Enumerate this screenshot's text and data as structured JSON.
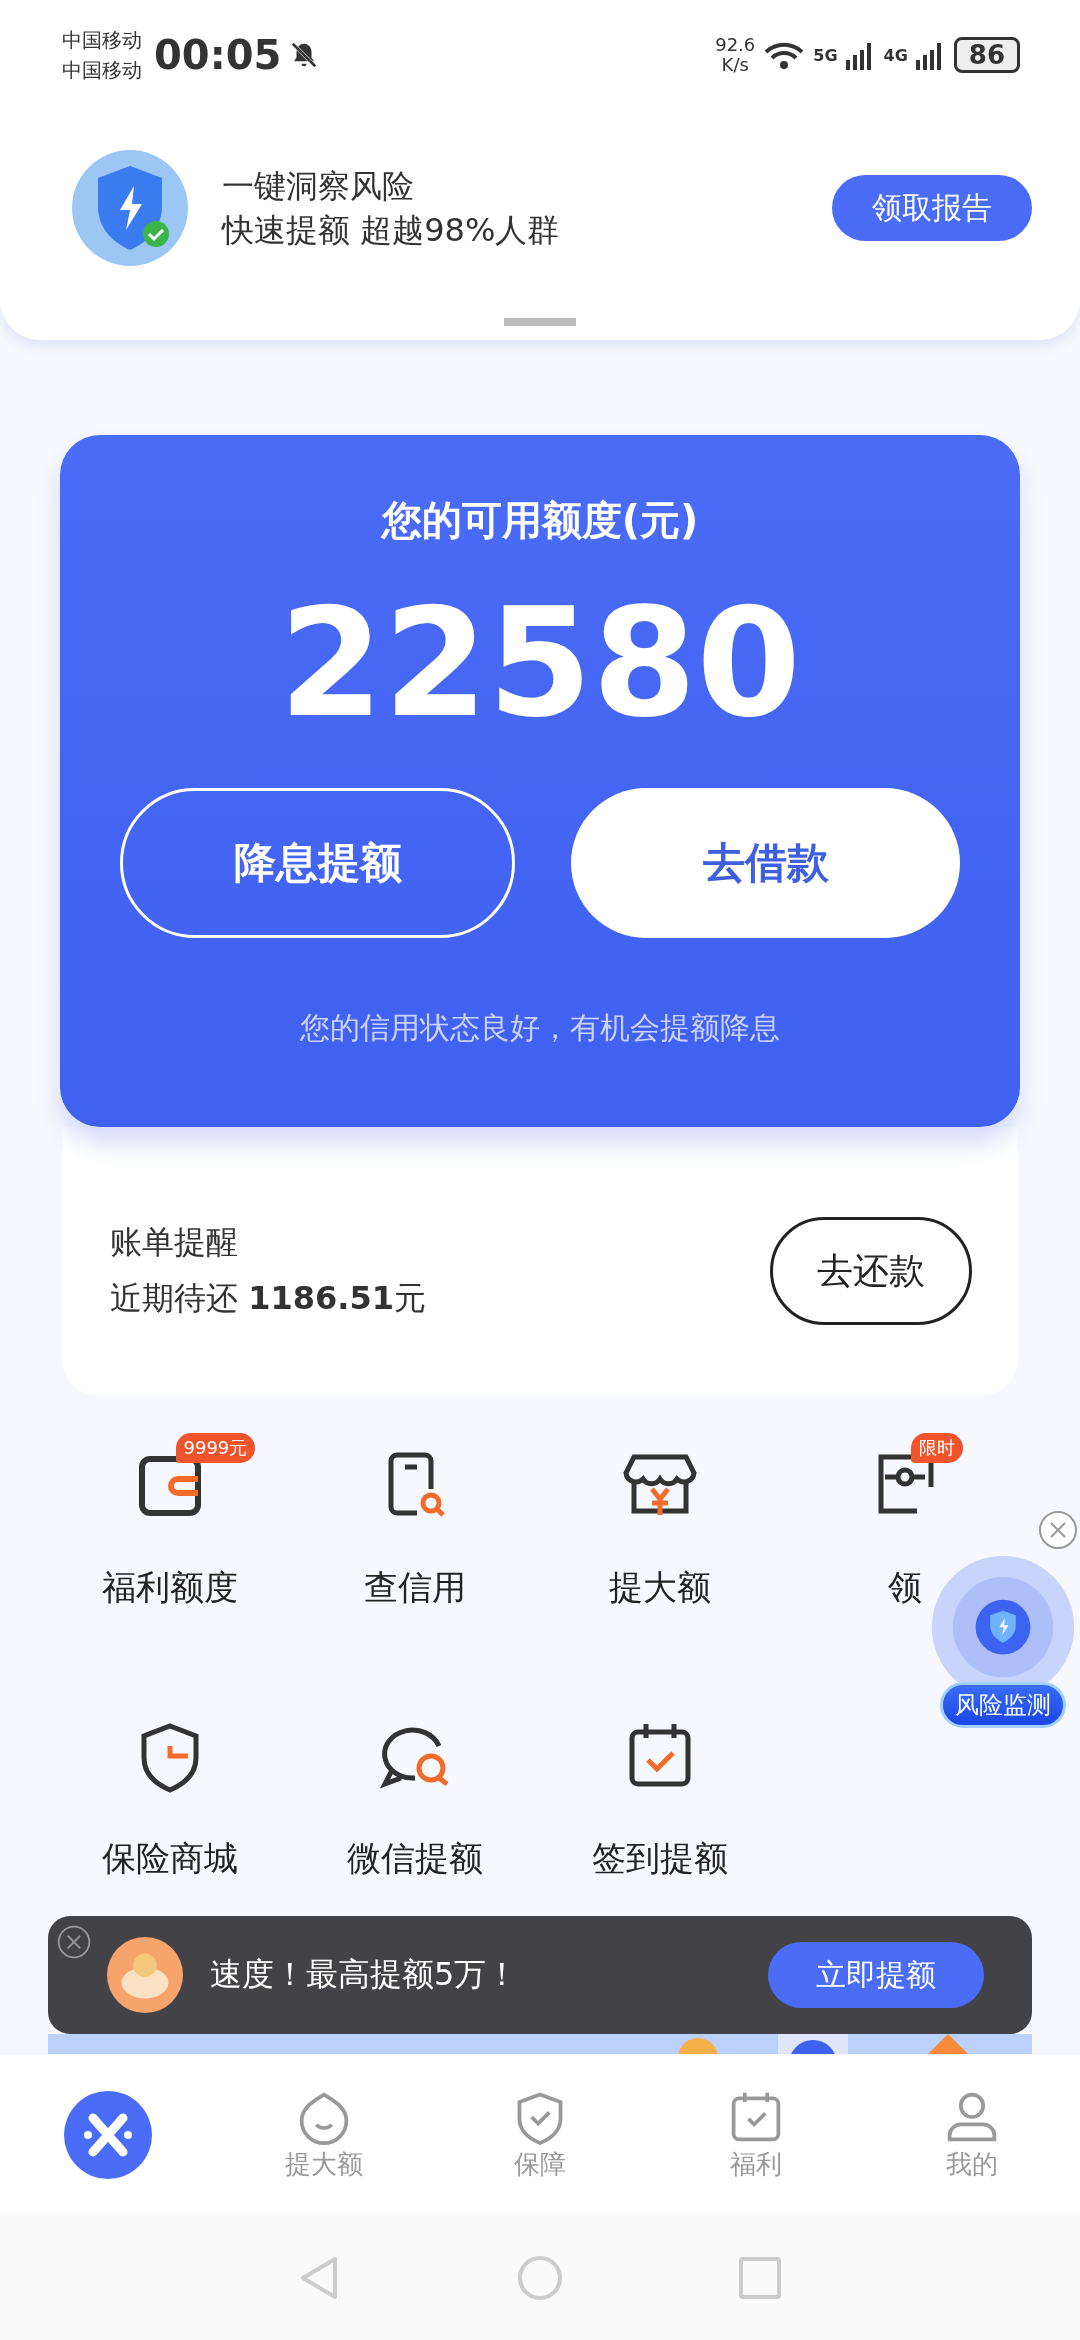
{
  "status_bar": {
    "carriers": [
      "中国移动",
      "中国移动"
    ],
    "time": "00:05",
    "speed": "92.6",
    "speed_unit": "K/s",
    "net1": "5G",
    "net2": "4G",
    "battery": "86"
  },
  "promo": {
    "line1": "一键洞察风险",
    "line2": "快速提额 超越98%人群",
    "button": "领取报告"
  },
  "credit_card": {
    "title": "您的可用额度(元)",
    "amount": "22580",
    "buttons": [
      {
        "label": "降息提额",
        "kind": "outline"
      },
      {
        "label": "去借款",
        "kind": "solid"
      }
    ],
    "note": "您的信用状态良好，有机会提额降息"
  },
  "bill": {
    "title": "账单提醒",
    "text": "近期待还 **1186.51**元",
    "button": "去还款"
  },
  "grid": [
    {
      "label": "福利额度",
      "badge": "9999元"
    },
    {
      "label": "查信用"
    },
    {
      "label": "提大额"
    },
    {
      "label": "领",
      "badge": "限时"
    },
    {
      "label": "保险商城"
    },
    {
      "label": "微信提额"
    },
    {
      "label": "签到提额"
    }
  ],
  "float_widget": {
    "label": "风险监测"
  },
  "toast": {
    "text": "速度！最高提额5万！",
    "button": "立即提额"
  },
  "nav": [
    {
      "selected": true
    },
    {
      "label": "提大额",
      "selected": false
    },
    {
      "label": "保障",
      "selected": false
    },
    {
      "label": "福利",
      "selected": false
    },
    {
      "label": "我的",
      "selected": false
    }
  ]
}
